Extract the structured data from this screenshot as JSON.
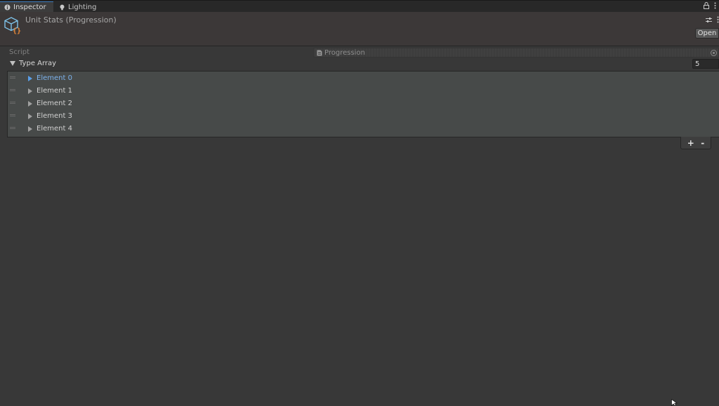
{
  "tabs": [
    {
      "label": "Inspector",
      "icon": "info-icon"
    },
    {
      "label": "Lighting",
      "icon": "bulb-icon"
    }
  ],
  "header": {
    "title": "Unit Stats (Progression)",
    "open_label": "Open"
  },
  "script": {
    "label": "Script",
    "value": "Progression"
  },
  "array": {
    "label": "Type Array",
    "size": "5",
    "elements": [
      "Element 0",
      "Element 1",
      "Element 2",
      "Element 3",
      "Element 4"
    ],
    "selected_index": 0,
    "add_label": "+",
    "remove_label": "-"
  },
  "colors": {
    "selection": "#7cb2ec",
    "accent": "#3a79bb",
    "background": "#383838"
  }
}
